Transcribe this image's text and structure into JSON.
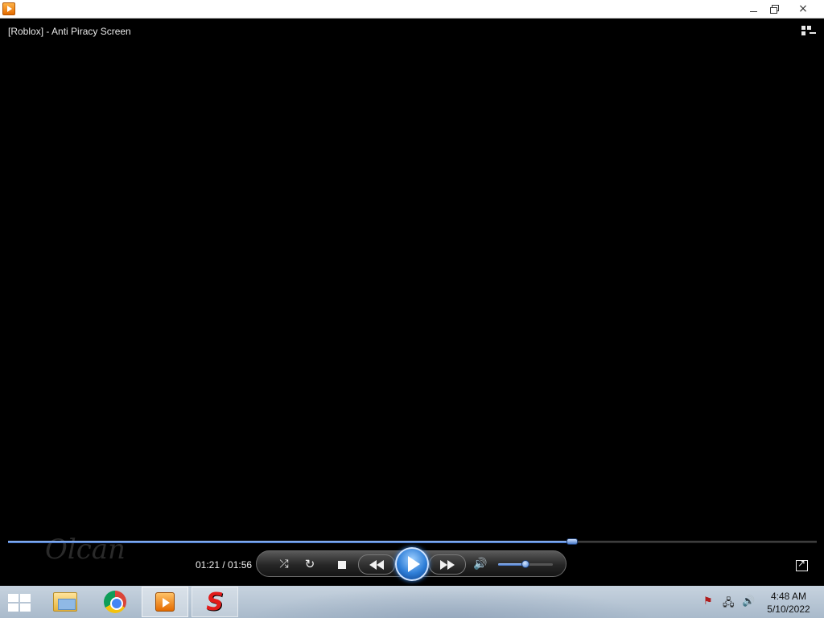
{
  "window": {
    "icon": "media-player-icon",
    "controls": {
      "minimize": "minimize-icon",
      "restore": "restore-icon",
      "close": "×"
    }
  },
  "player": {
    "media_title": "[Roblox] - Anti Piracy Screen",
    "switch_icon": "switch-to-library-icon",
    "watermark": "Olcan",
    "time_display": "01:21 / 01:56",
    "elapsed_seconds": 81,
    "duration_seconds": 116,
    "progress_fraction": 0.698,
    "volume_fraction": 0.5,
    "state": "paused",
    "buttons": {
      "shuffle": "⤮",
      "repeat": "↻",
      "stop": "stop-icon",
      "previous": "previous-icon",
      "play": "play-icon",
      "next": "next-icon",
      "mute": "🔊",
      "fullscreen": "fullscreen-icon"
    },
    "colors": {
      "accent": "#3e78d0",
      "background": "#000000"
    }
  },
  "taskbar": {
    "start": "windows-logo-icon",
    "pinned": [
      "file-explorer-icon",
      "chrome-icon",
      "windows-media-player-icon",
      "red-s-app-icon"
    ],
    "tray": {
      "action_center": "⚑",
      "network": "🖧",
      "volume": "🔊"
    },
    "clock": {
      "time": "4:48 AM",
      "date": "5/10/2022"
    }
  }
}
